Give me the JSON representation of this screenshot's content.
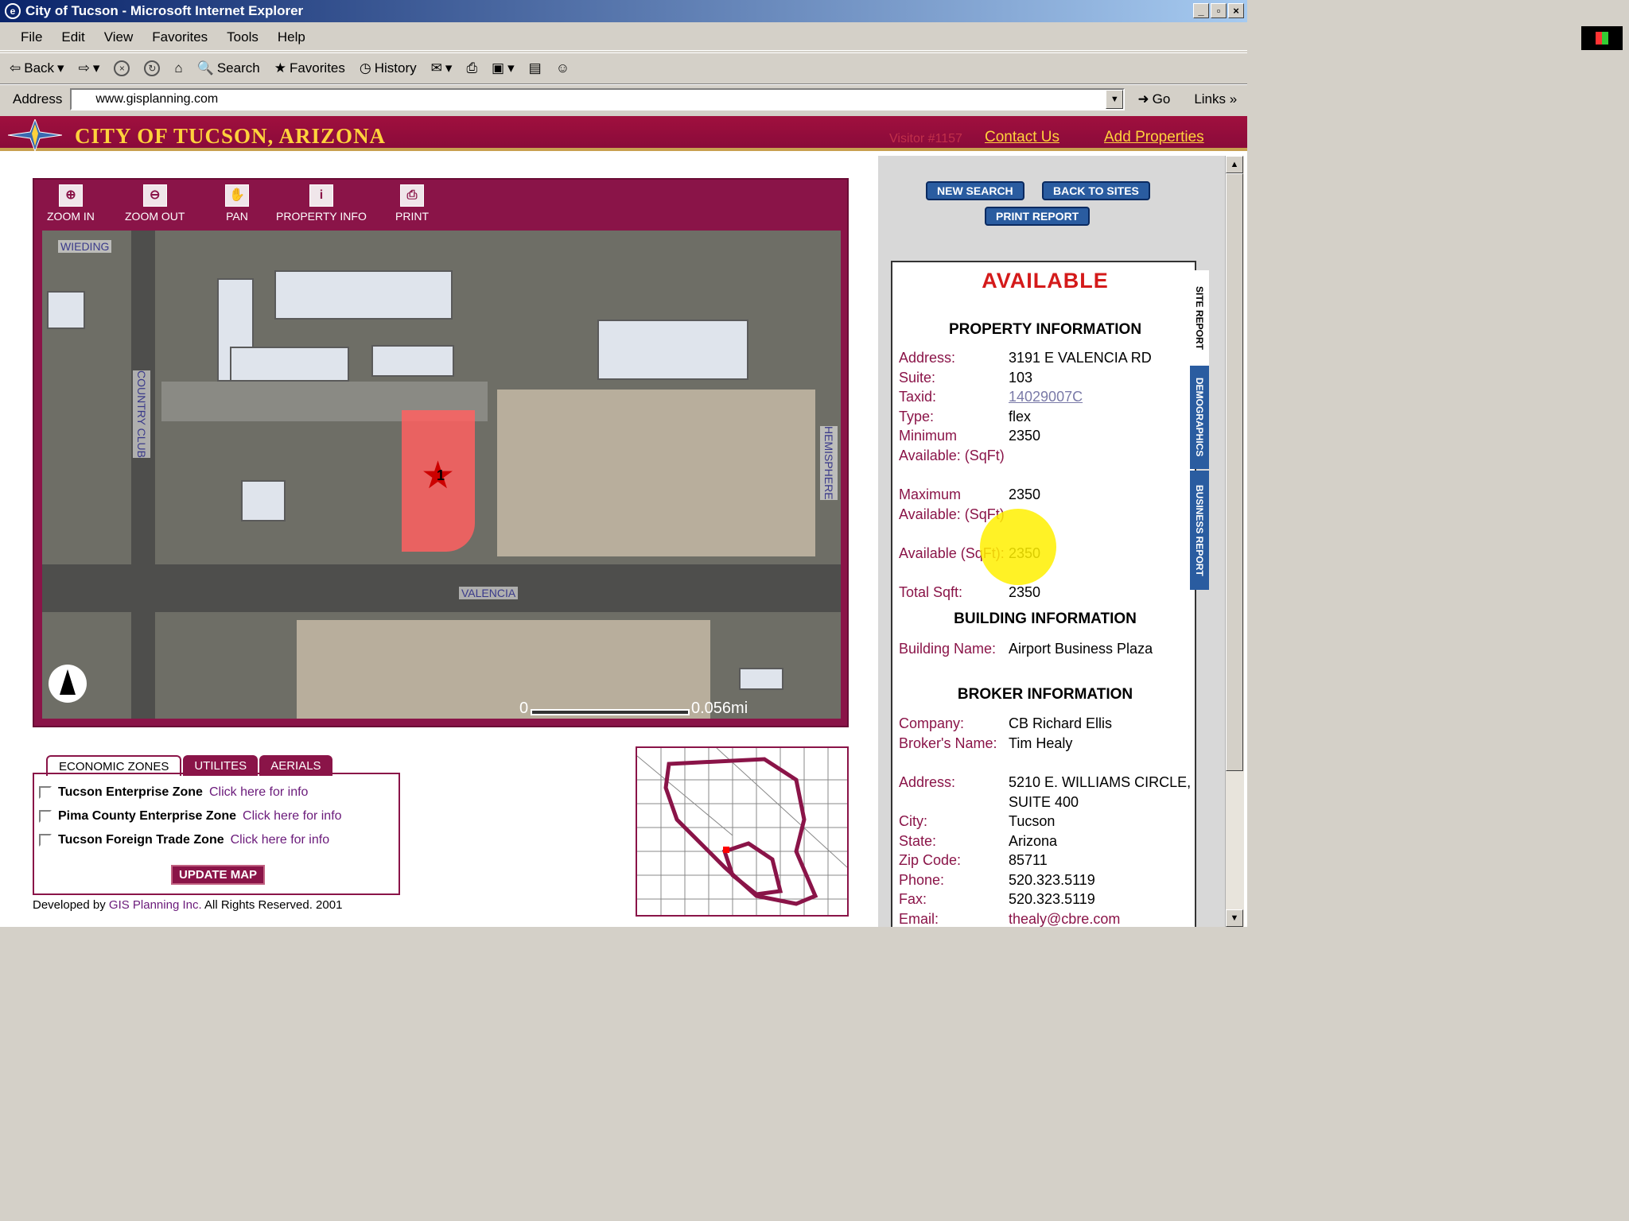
{
  "window": {
    "title": "City of Tucson - Microsoft Internet Explorer"
  },
  "menu": [
    "File",
    "Edit",
    "View",
    "Favorites",
    "Tools",
    "Help"
  ],
  "toolbar": {
    "back": "Back",
    "search": "Search",
    "favorites": "Favorites",
    "history": "History"
  },
  "address": {
    "label": "Address",
    "url": "www.gisplanning.com",
    "go": "Go",
    "links": "Links"
  },
  "banner": {
    "title": "CITY OF TUCSON, ARIZONA",
    "visitor": "Visitor #1157",
    "contact": "Contact Us",
    "add_properties": "Add Properties"
  },
  "map_tools": {
    "zoom_in": "ZOOM IN",
    "zoom_out": "ZOOM OUT",
    "pan": "PAN",
    "property_info": "PROPERTY INFO",
    "print": "PRINT"
  },
  "map": {
    "street_wieding": "WIEDING",
    "street_country_club": "COUNTRY CLUB",
    "street_hemisphere": "HEMISPHERE",
    "street_valencia": "VALENCIA",
    "marker": "1",
    "scale_start": "0",
    "scale_end": "0.056mi"
  },
  "layer_tabs": [
    "ECONOMIC ZONES",
    "UTILITES",
    "AERIALS"
  ],
  "zones": [
    {
      "name": "Tucson Enterprise Zone",
      "link": "Click here for info"
    },
    {
      "name": "Pima County Enterprise Zone",
      "link": "Click here for info"
    },
    {
      "name": "Tucson Foreign Trade Zone",
      "link": "Click here for info"
    }
  ],
  "update_map": "UPDATE MAP",
  "footer": {
    "prefix": "Developed by",
    "company": "GIS Planning Inc.",
    "suffix": "All Rights Reserved. 2001"
  },
  "report_buttons": {
    "new_search": "NEW SEARCH",
    "back_to_sites": "BACK TO SITES",
    "print_report": "PRINT REPORT"
  },
  "report": {
    "status": "AVAILABLE",
    "property_heading": "PROPERTY INFORMATION",
    "building_heading": "BUILDING INFORMATION",
    "broker_heading": "BROKER INFORMATION",
    "side_tabs": [
      "SITE REPORT",
      "DEMOGRAPHICS",
      "BUSINESS REPORT"
    ],
    "property": [
      {
        "k": "Address:",
        "v": "3191 E VALENCIA RD"
      },
      {
        "k": "Suite:",
        "v": "103"
      },
      {
        "k": "Taxid:",
        "v": "14029007C"
      },
      {
        "k": "Type:",
        "v": "flex"
      },
      {
        "k": "Minimum Available: (SqFt)",
        "v": "2350"
      },
      {
        "k": "Maximum Available: (SqFt)",
        "v": "2350"
      },
      {
        "k": "Available (SqFt):",
        "v": "2350"
      },
      {
        "k": "Total Sqft:",
        "v": "2350"
      }
    ],
    "building": [
      {
        "k": "Building Name:",
        "v": "Airport Business Plaza"
      }
    ],
    "broker": [
      {
        "k": "Company:",
        "v": "CB Richard Ellis"
      },
      {
        "k": "Broker's Name:",
        "v": "Tim Healy"
      },
      {
        "k": "Address:",
        "v": "5210 E. WILLIAMS CIRCLE, SUITE 400"
      },
      {
        "k": "City:",
        "v": "Tucson"
      },
      {
        "k": "State:",
        "v": "Arizona"
      },
      {
        "k": "Zip Code:",
        "v": "85711"
      },
      {
        "k": "Phone:",
        "v": "520.323.5119"
      },
      {
        "k": "Fax:",
        "v": "520.323.5119"
      },
      {
        "k": "Email:",
        "v": "thealy@cbre.com"
      }
    ]
  }
}
